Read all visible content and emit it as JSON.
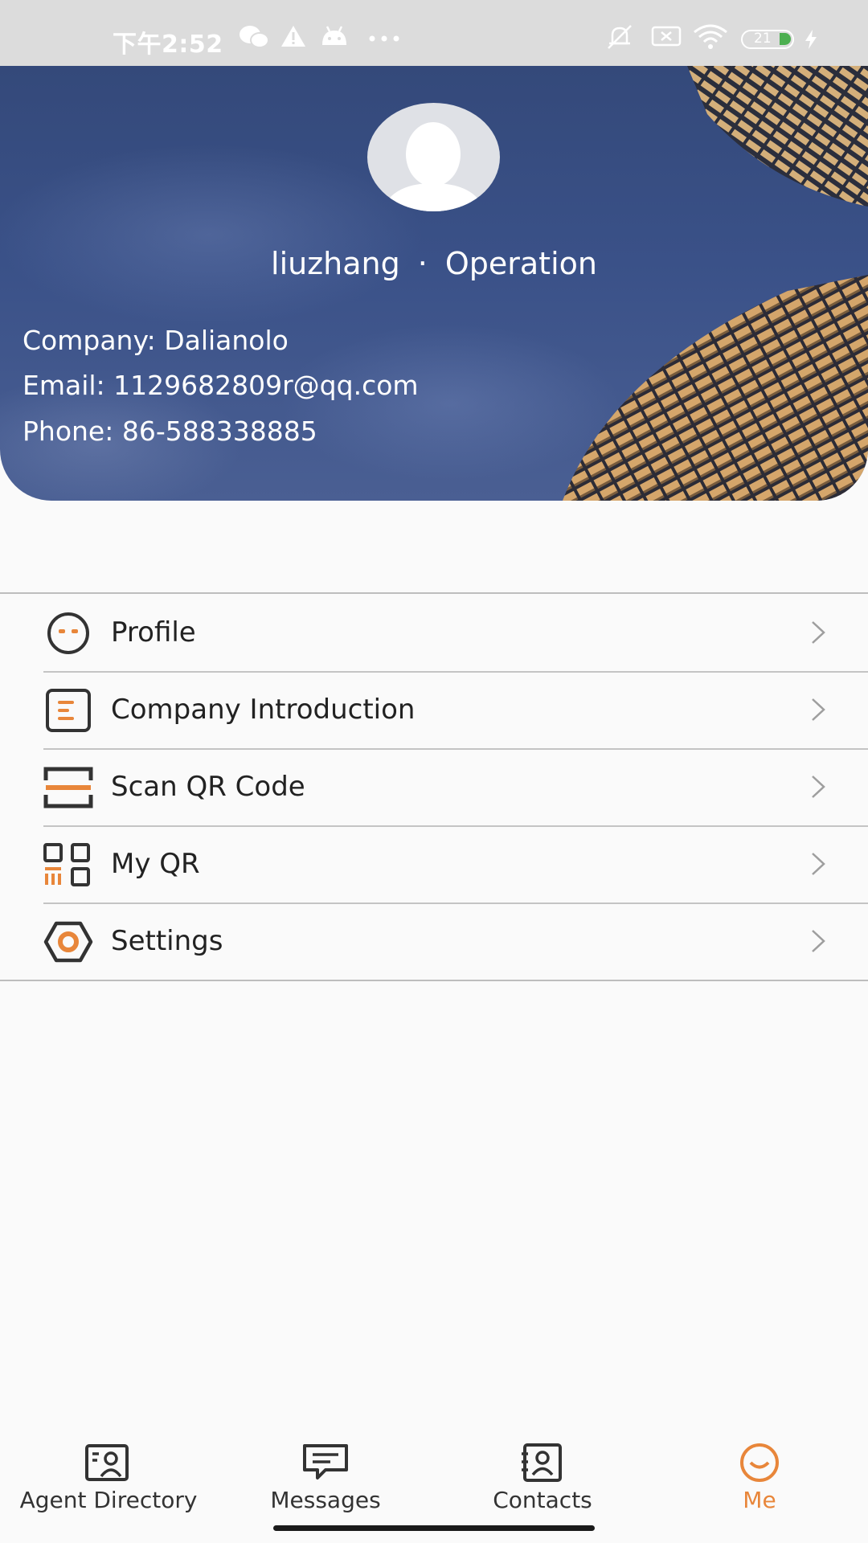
{
  "status_bar": {
    "time": "下午2:52",
    "battery": "21"
  },
  "profile": {
    "username": "liuzhang",
    "separator": "·",
    "department": "Operation",
    "company_line": "Company: Dalianolo",
    "email_line": "Email: 1129682809r@qq.com",
    "phone_line": "Phone: 86-588338885"
  },
  "menu": {
    "items": [
      {
        "label": "Profile",
        "icon": "face-icon"
      },
      {
        "label": "Company Introduction",
        "icon": "document-icon"
      },
      {
        "label": "Scan QR Code",
        "icon": "scan-icon"
      },
      {
        "label": "My QR",
        "icon": "qr-code-icon"
      },
      {
        "label": "Settings",
        "icon": "settings-hex-icon"
      }
    ]
  },
  "bottom_nav": {
    "items": [
      {
        "label": "Agent Directory",
        "icon": "agent-directory-icon"
      },
      {
        "label": "Messages",
        "icon": "message-icon"
      },
      {
        "label": "Contacts",
        "icon": "contacts-icon"
      },
      {
        "label": "Me",
        "icon": "me-face-icon",
        "active": true
      }
    ]
  },
  "colors": {
    "accent": "#e8863a",
    "header_blue": "#3a5188",
    "icon_dark": "#333333"
  }
}
